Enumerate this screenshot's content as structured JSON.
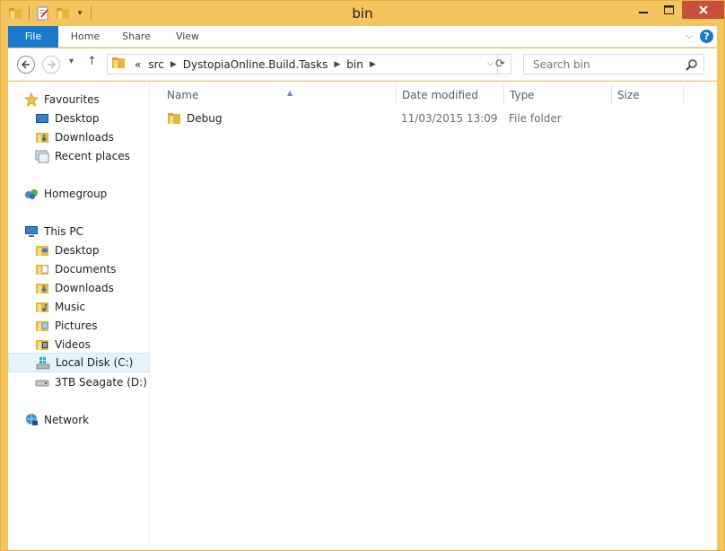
{
  "window": {
    "title": "bin",
    "accent_color": "#f4c55f",
    "close_color": "#c7503d"
  },
  "quick_access": {
    "icons": [
      "folder-icon",
      "properties-icon",
      "new-folder-icon",
      "customize-dropdown-icon"
    ]
  },
  "ribbon": {
    "tabs": [
      {
        "label": "File"
      },
      {
        "label": "Home"
      },
      {
        "label": "Share"
      },
      {
        "label": "View"
      }
    ],
    "file_tab_color": "#1979ca"
  },
  "address": {
    "overflow": "«",
    "crumbs": [
      "src",
      "DystopiaOnline.Build.Tasks",
      "bin"
    ]
  },
  "search": {
    "placeholder": "Search bin"
  },
  "navigation": {
    "favourites": {
      "label": "Favourites",
      "items": [
        {
          "label": "Desktop",
          "icon": "desktop-icon"
        },
        {
          "label": "Downloads",
          "icon": "downloads-folder-icon"
        },
        {
          "label": "Recent places",
          "icon": "recent-places-icon"
        }
      ]
    },
    "homegroup": {
      "label": "Homegroup"
    },
    "this_pc": {
      "label": "This PC",
      "items": [
        {
          "label": "Desktop",
          "icon": "desktop-folder-icon"
        },
        {
          "label": "Documents",
          "icon": "documents-folder-icon"
        },
        {
          "label": "Downloads",
          "icon": "downloads-folder-icon"
        },
        {
          "label": "Music",
          "icon": "music-folder-icon"
        },
        {
          "label": "Pictures",
          "icon": "pictures-folder-icon"
        },
        {
          "label": "Videos",
          "icon": "videos-folder-icon"
        },
        {
          "label": "Local Disk (C:)",
          "icon": "local-disk-icon",
          "selected": true
        },
        {
          "label": "3TB Seagate (D:)",
          "icon": "external-drive-icon"
        }
      ]
    },
    "network": {
      "label": "Network"
    }
  },
  "columns": {
    "name": "Name",
    "date_modified": "Date modified",
    "type": "Type",
    "size": "Size"
  },
  "files": [
    {
      "name": "Debug",
      "date_modified": "11/03/2015 13:09",
      "type": "File folder",
      "size": ""
    }
  ]
}
